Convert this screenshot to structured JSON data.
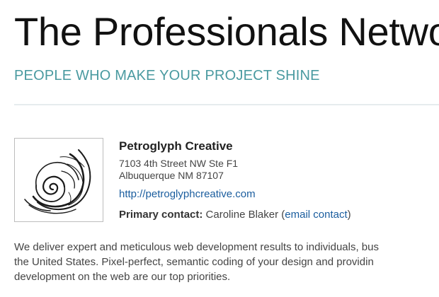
{
  "header": {
    "title": "The Professionals Netwo",
    "tagline": "PEOPLE WHO MAKE YOUR PROJECT SHINE"
  },
  "listing": {
    "company_name": "Petroglyph Creative",
    "address_line1": "7103 4th Street NW Ste F1",
    "address_line2": "Albuquerque NM 87107",
    "website": "http://petroglyphcreative.com",
    "contact_label": "Primary contact:",
    "contact_name": "Caroline Blaker",
    "paren_open": "(",
    "email_label": "email contact",
    "paren_close": ")",
    "logo_icon": "spiral-petroglyph-logo",
    "description_lines": [
      "We deliver expert and meticulous web development results to individuals, bus",
      "the United States. Pixel-perfect, semantic coding of your design and providin",
      "development on the web are our top priorities."
    ]
  },
  "colors": {
    "tagline": "#4a9aa0",
    "link": "#1a5d9e",
    "title": "#111111"
  }
}
